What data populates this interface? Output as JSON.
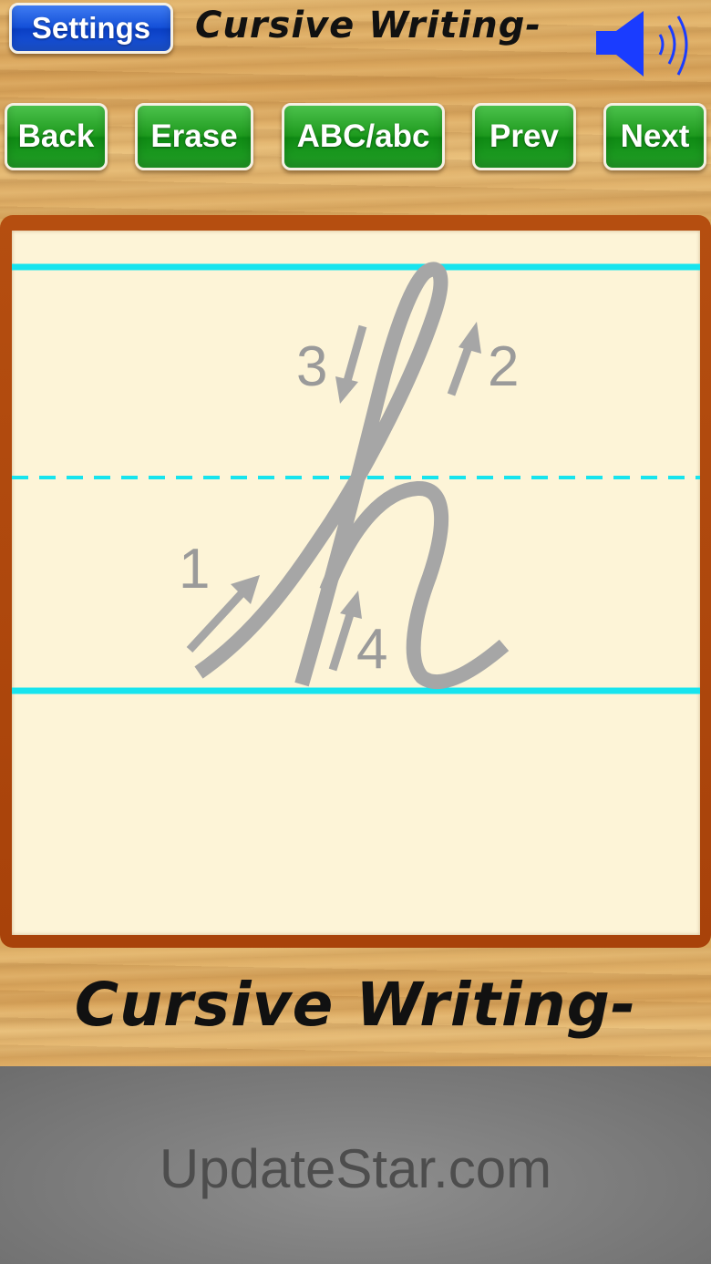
{
  "header": {
    "settings_label": "Settings",
    "title": "Cursive Writing-",
    "sound_icon": "speaker-sound-on-icon"
  },
  "toolbar": {
    "back_label": "Back",
    "erase_label": "Erase",
    "case_label": "ABC/abc",
    "prev_label": "Prev",
    "next_label": "Next"
  },
  "tracing": {
    "letter": "h",
    "stroke_numbers": [
      "1",
      "2",
      "3",
      "4"
    ],
    "guide_line_color": "#17e4ee",
    "letter_color": "#a6a6a6"
  },
  "footer": {
    "title": "Cursive Writing-"
  },
  "ad": {
    "text": "UpdateStar.com"
  },
  "colors": {
    "button_blue": "#1450d8",
    "button_green": "#1e9a1e",
    "board_frame": "#b54e10",
    "paper": "#fdf4d7"
  }
}
